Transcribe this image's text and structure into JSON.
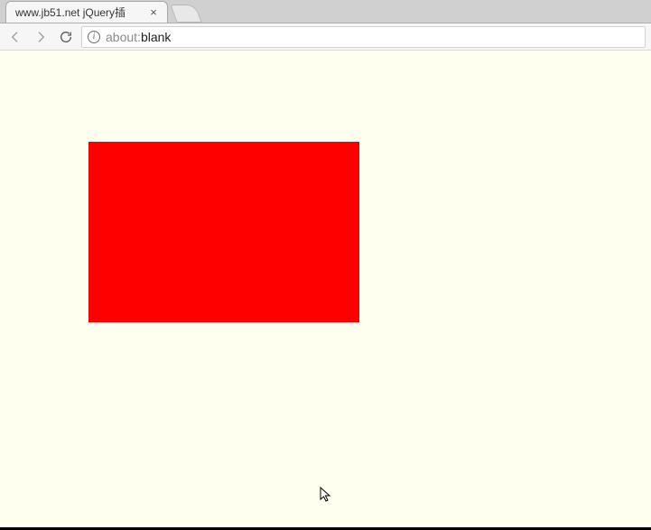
{
  "tab": {
    "title": "www.jb51.net jQuery插",
    "close_label": "×"
  },
  "toolbar": {
    "info_label": "i"
  },
  "address": {
    "prefix": "about:",
    "path": "blank"
  },
  "content": {
    "box_color": "#ff0000",
    "bg_color": "#fffff0"
  }
}
